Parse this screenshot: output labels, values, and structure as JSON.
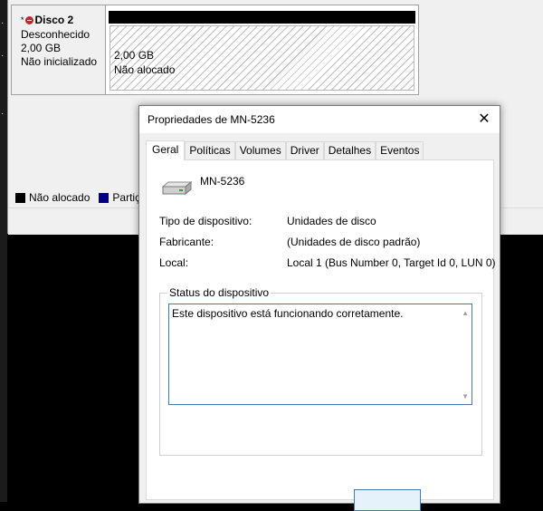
{
  "disk_management": {
    "disk": {
      "marker": "*",
      "name": "Disco 2",
      "state": "Desconhecido",
      "size": "2,00 GB",
      "init_state": "Não inicializado"
    },
    "volume": {
      "size": "2,00 GB",
      "status": "Não alocado"
    },
    "legend": [
      {
        "label": "Não alocado",
        "color": "#000000"
      },
      {
        "label": "Partiç",
        "color": "#000080"
      }
    ]
  },
  "dialog": {
    "title": "Propriedades de MN-5236",
    "close_label": "✕",
    "tabs": [
      "Geral",
      "Políticas",
      "Volumes",
      "Driver",
      "Detalhes",
      "Eventos"
    ],
    "device_name": "MN-5236",
    "properties": [
      {
        "label": "Tipo de dispositivo:",
        "value": "Unidades de disco"
      },
      {
        "label": "Fabricante:",
        "value": "(Unidades de disco padrão)"
      },
      {
        "label": "Local:",
        "value": "Local 1 (Bus Number 0, Target Id 0, LUN 0)"
      }
    ],
    "status_group_label": "Status do dispositivo",
    "status_text": "Este dispositivo está funcionando corretamente."
  }
}
